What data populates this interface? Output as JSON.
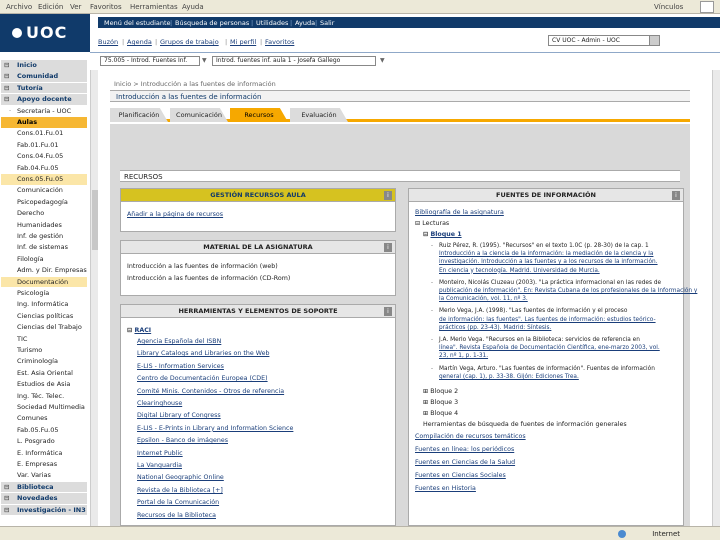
{
  "browser": {
    "menu": [
      "Archivo",
      "Edición",
      "Ver",
      "Favoritos",
      "Herramientas",
      "Ayuda"
    ],
    "links_label": "Vínculos"
  },
  "header": {
    "logo": "UOC",
    "util_links": [
      "Menú del estudiante",
      "Búsqueda de personas",
      "Utilidades",
      "Ayuda",
      "Salir"
    ],
    "sub_links": [
      "Buzón",
      "Agenda",
      "Grupos de trabajo",
      "Mi perfil",
      "Favoritos"
    ],
    "role_select": "CV UOC - Admin - UOC"
  },
  "context": {
    "course_select": "75.005 - Introd. Fuentes Inf.",
    "topic_select": "Introd. fuentes inf. aula 1 - Josefa Gallego"
  },
  "sidebar": {
    "items": [
      {
        "label": "Inicio",
        "type": "sec"
      },
      {
        "label": "Comunidad",
        "type": "sec"
      },
      {
        "label": "Tutoría",
        "type": "sec"
      },
      {
        "label": "Apoyo docente",
        "type": "sec"
      },
      {
        "label": "Secretaría - UOC",
        "type": "bullet"
      },
      {
        "label": "Aulas",
        "type": "sel"
      },
      {
        "label": "Cons.01.Fu.01",
        "type": "sub"
      },
      {
        "label": "Fab.01.Fu.01",
        "type": "sub"
      },
      {
        "label": "Cons.04.Fu.05",
        "type": "sub"
      },
      {
        "label": "Fab.04.Fu.05",
        "type": "sub"
      },
      {
        "label": "Cons.05.Fu.05",
        "type": "hl"
      },
      {
        "label": "Comunicación",
        "type": "sub"
      },
      {
        "label": "Psicopedagogía",
        "type": "sub"
      },
      {
        "label": "Derecho",
        "type": "sub"
      },
      {
        "label": "Humanidades",
        "type": "sub"
      },
      {
        "label": "Inf. de gestión",
        "type": "sub"
      },
      {
        "label": "Inf. de sistemas",
        "type": "sub"
      },
      {
        "label": "Filología",
        "type": "sub"
      },
      {
        "label": "Adm. y Dir. Empresas",
        "type": "sub"
      },
      {
        "label": "Documentación",
        "type": "hl"
      },
      {
        "label": "Psicología",
        "type": "sub"
      },
      {
        "label": "Ing. Informática",
        "type": "sub"
      },
      {
        "label": "Ciencias políticas",
        "type": "sub"
      },
      {
        "label": "Ciencias del Trabajo",
        "type": "sub"
      },
      {
        "label": "TIC",
        "type": "sub"
      },
      {
        "label": "Turismo",
        "type": "sub"
      },
      {
        "label": "Criminología",
        "type": "sub"
      },
      {
        "label": "Est. Asia Oriental",
        "type": "sub"
      },
      {
        "label": "Estudios de Asia",
        "type": "sub"
      },
      {
        "label": "Ing. Téc. Telec.",
        "type": "sub"
      },
      {
        "label": "Sociedad Multimedia",
        "type": "sub"
      },
      {
        "label": "Comunes",
        "type": "sub"
      },
      {
        "label": "Fab.05.Fu.05",
        "type": "sub"
      },
      {
        "label": "L. Posgrado",
        "type": "sub"
      },
      {
        "label": "E. Informática",
        "type": "sub"
      },
      {
        "label": "E. Empresas",
        "type": "sub"
      },
      {
        "label": "Var. Varias",
        "type": "sub"
      },
      {
        "label": "Biblioteca",
        "type": "sec"
      },
      {
        "label": "Novedades",
        "type": "sec"
      },
      {
        "label": "Investigación - IN3",
        "type": "sec"
      }
    ]
  },
  "main": {
    "breadcrumb": "Inicio > Introducción a las fuentes de información",
    "page_title": "Introducción a las fuentes de información",
    "tabs": [
      "Planificación",
      "Comunicación",
      "Recursos",
      "Evaluación"
    ],
    "active_tab": 2,
    "section_title": "RECURSOS",
    "gestion": {
      "title": "GESTIÓN RECURSOS AULA",
      "line": "Añadir a la página de recursos"
    },
    "material": {
      "title": "MATERIAL DE LA ASIGNATURA",
      "lines": [
        "Introducción a las fuentes de información (web)",
        "Introducción a las fuentes de información (CD-Rom)"
      ]
    },
    "herramientas": {
      "title": "HERRAMIENTAS Y ELEMENTOS DE SOPORTE",
      "group": "RACI",
      "links": [
        "Agencia Española del ISBN",
        "Library Catalogs and Libraries on the Web",
        "E-LIS - Information Services",
        "Centro de Documentación Europea (CDE)",
        "Comité Minis. Contenidos - Otros de referencia",
        "Clearinghouse",
        "Digital Library of Congress",
        "E-LIS - E-Prints in Library and Information Science",
        "Epsilon - Banco de imágenes",
        "Internet Public",
        "La Vanguardia",
        "National Geographic Online",
        "Revista de la Biblioteca [+]",
        "Portal de la Comunicación",
        "Recursos de la Biblioteca"
      ]
    },
    "fuentes": {
      "title": "FUENTES DE INFORMACIÓN",
      "top_link": "Bibliografía de la asignatura",
      "lecturas": "Lecturas",
      "bloque1": "Bloque 1",
      "items": [
        "Ruiz Pérez, R. (1995). \"Recursos\" en el texto 1.0C (p. 28-30) de la cap. 1",
        "Introducción a la ciencia de la información: la mediación de la ciencia y la",
        "investigación. Introducción a las fuentes y a los recursos de la información.",
        "En ciencia y tecnología. Madrid. Universidad de Murcia.",
        "Monteiro, Nicolás Cluzeau (2003). \"La práctica informacional en las redes de",
        "publicación de información\". En: Revista Cubana de los profesionales de la Información y",
        "la Comunicación, vol. 11, nº 3.",
        "Merlo Vega, J.A. (1998). \"Las fuentes de información y el proceso",
        "de información: las fuentes\". Las fuentes de información: estudios teórico-",
        "prácticos (pp. 23-43). Madrid: Síntesis.",
        "J.A. Merlo Vega. \"Recursos en la Biblioteca: servicios de referencia en",
        "línea\". Revista Española de Documentación Científica, ene-marzo 2003, vol.",
        "23, nº 1, p. 1-31.",
        "Martín Vega, Arturo. \"Las fuentes de información\". Fuentes de información",
        "general (cap. 1), p. 33-38. Gijón: Ediciones Trea."
      ],
      "bloques": [
        "Bloque 2",
        "Bloque 3",
        "Bloque 4"
      ],
      "plain": "Herramientas de búsqueda de fuentes de información generales",
      "bottom_links": [
        "Compilación de recursos temáticos",
        "Fuentes en línea: los periódicos",
        "Fuentes en Ciencias de la Salud",
        "Fuentes en Ciencias Sociales",
        "Fuentes en Historia"
      ]
    }
  },
  "status": {
    "zone": "Internet"
  },
  "colors": {
    "uoc_blue": "#103a6a",
    "tab_orange": "#f6a800",
    "panel_yellow": "#d6c220"
  }
}
